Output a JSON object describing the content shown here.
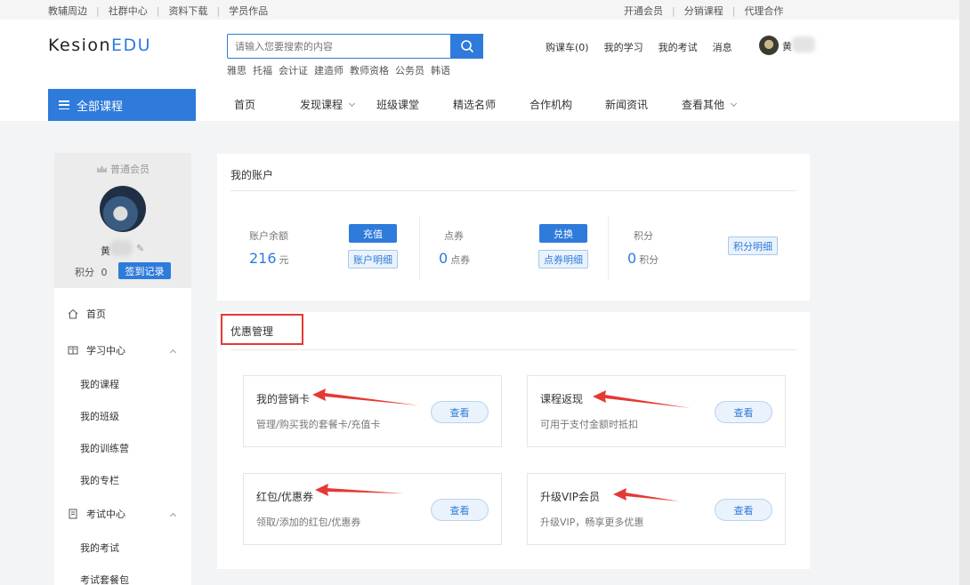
{
  "topbar": {
    "left_links": [
      "教辅周边",
      "社群中心",
      "资料下载",
      "学员作品"
    ],
    "right_links": [
      "开通会员",
      "分销课程",
      "代理合作"
    ]
  },
  "header": {
    "logo_main": "Kesion",
    "logo_accent": "EDU",
    "search_placeholder": "请输入您要搜索的内容",
    "hot_tags": [
      "雅思",
      "托福",
      "会计证",
      "建造师",
      "教师资格",
      "公务员",
      "韩语"
    ],
    "user_nav": [
      "购课车(0)",
      "我的学习",
      "我的考试",
      "消息"
    ],
    "user_name": "黄"
  },
  "nav": {
    "all_courses": "全部课程",
    "items": [
      "首页",
      "发现课程",
      "班级课堂",
      "精选名师",
      "合作机构",
      "新闻资讯",
      "查看其他"
    ]
  },
  "profile": {
    "member_level": "普通会员",
    "name": "黄",
    "points_label": "积分",
    "points_value": "0",
    "sign_button": "签到记录"
  },
  "sidebar": {
    "home": "首页",
    "study_center": "学习中心",
    "study_items": [
      "我的课程",
      "我的班级",
      "我的训练营",
      "我的专栏"
    ],
    "exam_center": "考试中心",
    "exam_items": [
      "我的考试",
      "考试套餐包"
    ]
  },
  "account": {
    "title": "我的账户",
    "balance_label": "账户余额",
    "balance_value": "216",
    "balance_unit": "元",
    "recharge_button": "充值",
    "balance_detail_button": "账户明细",
    "coupon_label": "点券",
    "coupon_value": "0",
    "coupon_unit": "点券",
    "exchange_button": "兑换",
    "coupon_detail_button": "点券明细",
    "score_label": "积分",
    "score_value": "0",
    "score_unit": "积分",
    "score_detail_button": "积分明细"
  },
  "promo": {
    "title": "优惠管理",
    "view_label": "查看",
    "items": [
      {
        "title": "我的营销卡",
        "desc": "管理/购买我的套餐卡/充值卡"
      },
      {
        "title": "课程返现",
        "desc": "可用于支付金额时抵扣"
      },
      {
        "title": "红包/优惠券",
        "desc": "领取/添加的红包/优惠券"
      },
      {
        "title": "升级VIP会员",
        "desc": "升级VIP，畅享更多优惠"
      }
    ]
  },
  "colors": {
    "accent": "#2e7bdc",
    "highlight": "#e53935"
  }
}
